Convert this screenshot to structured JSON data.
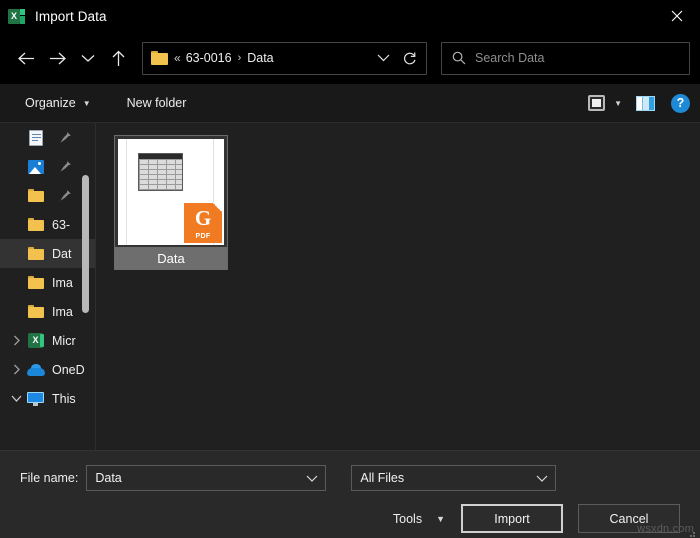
{
  "window": {
    "title": "Import Data",
    "app_icon": "excel-icon",
    "close_label": "✕"
  },
  "nav": {
    "back": "back-arrow",
    "forward": "forward-arrow",
    "recent": "recent-locations-chevron",
    "up": "up-arrow",
    "address": {
      "folder_icon": "folder-icon",
      "overflow": "«",
      "crumbs": [
        "63-0016",
        "Data"
      ],
      "separator": "›",
      "dropdown": "chevron-down-icon",
      "refresh": "refresh-icon"
    },
    "search": {
      "icon": "search-icon",
      "placeholder": "Search Data",
      "value": ""
    }
  },
  "commandbar": {
    "organize_label": "Organize",
    "new_folder_label": "New folder",
    "view_icon": "view-mode-icon",
    "view_caret": "chevron-down-icon",
    "preview_pane_icon": "preview-pane-icon",
    "help_icon": "help-icon",
    "help_glyph": "?"
  },
  "sidebar": {
    "items": [
      {
        "label": "",
        "icon": "documents-icon",
        "pinned": true,
        "chevron": "none",
        "indent": 1,
        "selected": false
      },
      {
        "label": "",
        "icon": "pictures-icon",
        "pinned": true,
        "chevron": "none",
        "indent": 1,
        "selected": false
      },
      {
        "label": "",
        "icon": "folder-icon",
        "pinned": true,
        "chevron": "none",
        "indent": 1,
        "selected": false
      },
      {
        "label": "63-",
        "icon": "folder-icon",
        "pinned": false,
        "chevron": "none",
        "indent": 1,
        "selected": false
      },
      {
        "label": "Dat",
        "icon": "folder-icon",
        "pinned": false,
        "chevron": "none",
        "indent": 1,
        "selected": true
      },
      {
        "label": "Ima",
        "icon": "folder-icon",
        "pinned": false,
        "chevron": "none",
        "indent": 1,
        "selected": false
      },
      {
        "label": "Ima",
        "icon": "folder-icon",
        "pinned": false,
        "chevron": "none",
        "indent": 1,
        "selected": false
      },
      {
        "label": "Micr",
        "icon": "excel-icon",
        "pinned": false,
        "chevron": "right",
        "indent": 0,
        "selected": false
      },
      {
        "label": "OneD",
        "icon": "onedrive-icon",
        "pinned": false,
        "chevron": "right",
        "indent": 0,
        "selected": false
      },
      {
        "label": "This",
        "icon": "this-pc-icon",
        "pinned": false,
        "chevron": "down",
        "indent": 0,
        "selected": false
      }
    ],
    "scrollbar": "vertical-scrollbar"
  },
  "files": {
    "items": [
      {
        "name": "Data",
        "type": "pdf",
        "badge_text": "PDF",
        "badge_glyph": "G",
        "badge_color": "#f07b22",
        "selected": true
      }
    ]
  },
  "footer": {
    "filename_label": "File name:",
    "filename_value": "Data",
    "filetype_value": "All Files",
    "tools_label": "Tools",
    "import_label": "Import",
    "cancel_label": "Cancel",
    "watermark": "wsxdn.com"
  },
  "colors": {
    "titlebar_bg": "#000000",
    "window_bg": "#202020",
    "commandbar_bg": "#191919",
    "footer_bg": "#292929",
    "accent_blue": "#1e8ad6",
    "folder_yellow": "#f2c14e",
    "excel_green": "#217346",
    "pdf_orange": "#f07b22",
    "selection_gray": "#333333",
    "tile_label_gray": "#6e6e6e"
  }
}
